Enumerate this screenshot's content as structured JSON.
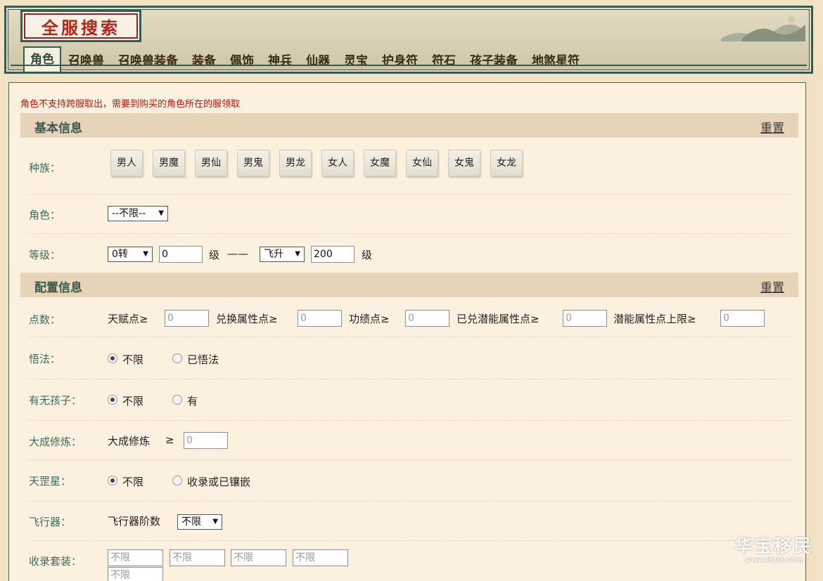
{
  "header": {
    "title": "全服搜索"
  },
  "nav": {
    "tabs": [
      "角色",
      "召唤兽",
      "召唤兽装备",
      "装备",
      "佩饰",
      "神兵",
      "仙器",
      "灵宝",
      "护身符",
      "符石",
      "孩子装备",
      "地煞星符"
    ],
    "active": "角色"
  },
  "notice": "角色不支持跨服取出，需要到购买的角色所在的服领取",
  "basic": {
    "title": "基本信息",
    "reset": "重置",
    "race_label": "种族：",
    "races": [
      "男人",
      "男魔",
      "男仙",
      "男鬼",
      "男龙",
      "女人",
      "女魔",
      "女仙",
      "女鬼",
      "女龙"
    ],
    "role_label": "角色：",
    "role_value": "--不限--",
    "level_label": "等级：",
    "level_from_select": "0转",
    "level_from_value": "0",
    "level_unit": "级",
    "level_sep": "——",
    "level_to_select": "飞升",
    "level_to_value": "200"
  },
  "config": {
    "title": "配置信息",
    "reset": "重置",
    "points_label": "点数：",
    "points": [
      {
        "label": "天赋点≥",
        "value": "0"
      },
      {
        "label": "兑换属性点≥",
        "value": "0"
      },
      {
        "label": "功绩点≥",
        "value": "0"
      },
      {
        "label": "已兑潜能属性点≥",
        "value": "0"
      },
      {
        "label": "潜能属性点上限≥",
        "value": "0"
      }
    ],
    "wufa_label": "悟法：",
    "wufa_options": [
      "不限",
      "已悟法"
    ],
    "child_label": "有无孩子：",
    "child_options": [
      "不限",
      "有"
    ],
    "dacheng_label": "大成修炼：",
    "dacheng_text": "大成修炼",
    "dacheng_ge": "≥",
    "dacheng_value": "0",
    "tiangang_label": "天罡星：",
    "tiangang_options": [
      "不限",
      "收录或已镶嵌"
    ],
    "aircraft_label": "飞行器：",
    "aircraft_text": "飞行器阶数",
    "aircraft_value": "不限",
    "suit_label": "收录套装：",
    "suit_values": [
      "不限",
      "不限",
      "不限",
      "不限",
      "不限"
    ]
  },
  "watermark": {
    "big": "华宝移民",
    "small": "www.ihb8.com"
  },
  "colors": {
    "accent": "#335c55",
    "notice": "#c0150e",
    "section_bg": "#e6d3b8",
    "panel_bg": "#fcf0de"
  }
}
